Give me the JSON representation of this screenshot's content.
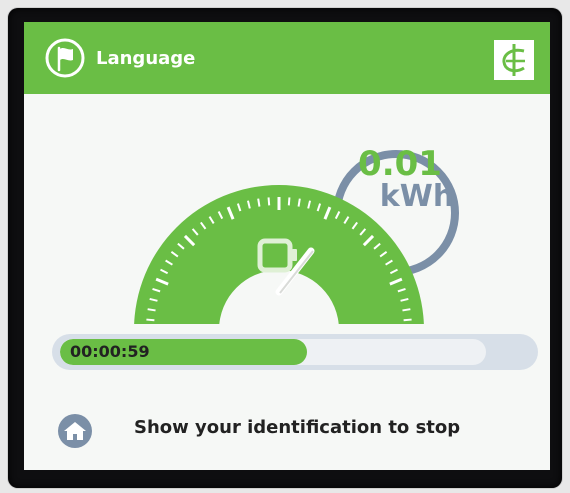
{
  "header": {
    "language_label": "Language",
    "background_color": "#6abe45",
    "flag_icon": "flag-icon",
    "logo_icon": "company-logo"
  },
  "energy": {
    "value": "0.01",
    "unit": "kWh",
    "value_color": "#6abe45",
    "ring_color": "#7b8fa7"
  },
  "gauge": {
    "color": "#6abe45",
    "tick_color": "#ffffff",
    "needle_level": 0.72,
    "center_icon": "battery-icon"
  },
  "progress": {
    "time": "00:00:59",
    "fill_fraction": 0.58,
    "fill_color": "#6abe45",
    "track_color": "#d7dfe8"
  },
  "footer": {
    "message": "Show your identification to stop",
    "home_icon": "home-icon"
  }
}
